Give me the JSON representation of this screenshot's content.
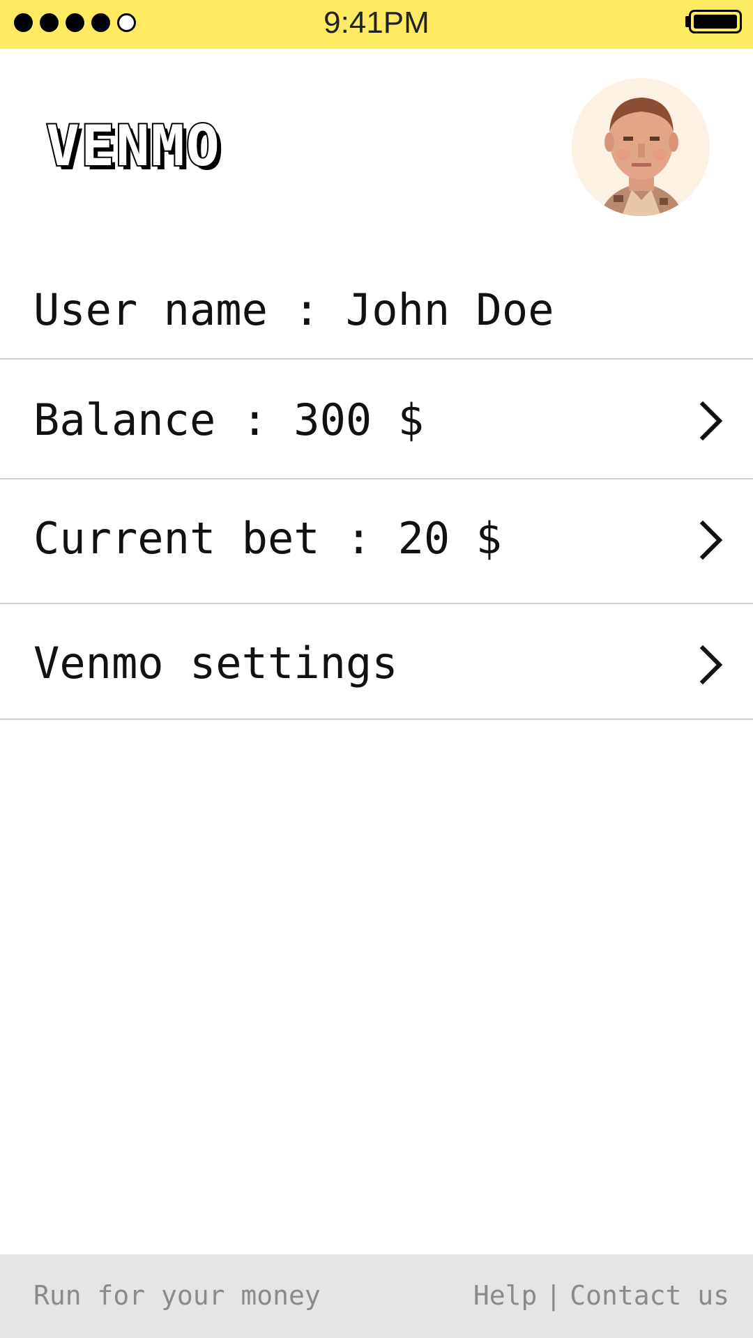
{
  "status_bar": {
    "time": "9:41PM",
    "signal_filled": 4,
    "signal_total": 5,
    "battery_level": 1.0,
    "background_color": "#feeb62"
  },
  "header": {
    "logo_text": "VENMO",
    "avatar_icon": "user-photo"
  },
  "info": {
    "username": "User name : John Doe",
    "balance": "Balance : 300 $",
    "current_bet": "Current bet : 20 $",
    "settings": "Venmo settings"
  },
  "icons": {
    "chevron": "chevron-right-icon"
  },
  "footer": {
    "tagline": "Run for your money",
    "help": "Help",
    "separator": "|",
    "contact": "Contact us",
    "background_color": "#e5e5e5"
  }
}
